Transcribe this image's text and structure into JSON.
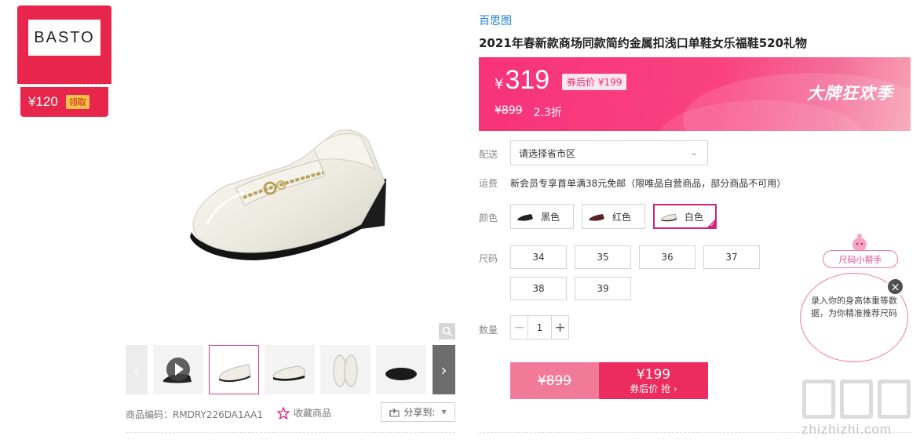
{
  "coupon": {
    "logo_text": "BASTO",
    "amount": "¥120",
    "claim_label": "领取"
  },
  "gallery": {
    "thumbnails": [
      {
        "label": "video"
      },
      {
        "label": "white-loafer-side"
      },
      {
        "label": "white-loafer-side-2"
      },
      {
        "label": "white-loafer-top"
      },
      {
        "label": "loafer-sole"
      },
      {
        "label": "loafer-partial"
      }
    ],
    "prev_arrow": "‹",
    "next_arrow": "›"
  },
  "product_meta": {
    "code": "商品编码：RMDRY226DA1AA1",
    "favorite": "收藏商品",
    "share": "分享到:"
  },
  "brand": "百思图",
  "title": "2021年春新款商场同款简约金属扣浅口单鞋女乐福鞋520礼物",
  "price": {
    "yen": "¥",
    "current": "319",
    "after_coupon": "券后价 ¥199",
    "original": "¥899",
    "discount": "2.3折",
    "promo": "大牌狂欢季"
  },
  "delivery": {
    "label": "配送",
    "placeholder": "请选择省市区"
  },
  "shipping": {
    "label": "运费",
    "text": "新会员专享首单满38元免邮（限唯品自营商品，部分商品不可用）"
  },
  "color": {
    "label": "颜色",
    "options": [
      "黑色",
      "红色",
      "白色"
    ],
    "selected": "白色"
  },
  "size": {
    "label": "尺码",
    "options": [
      "34",
      "35",
      "36",
      "37",
      "38",
      "39"
    ]
  },
  "quantity": {
    "label": "数量",
    "value": "1",
    "minus": "−",
    "plus": "+"
  },
  "buy_button": {
    "original": "¥899",
    "price": "¥199",
    "sub": "券后价 抢 ›"
  },
  "size_helper": {
    "tag": "尺码小帮手",
    "text": "录入你的身高体重等数据，为你精准推荐尺码"
  },
  "watermark": {
    "text": "zhizhizhi.com"
  },
  "colors": {
    "accent_pink": "#ec2b5e",
    "brand_blue": "#1c7ed6",
    "coupon_red": "#e8254a",
    "selected_border": "#d4217a"
  }
}
